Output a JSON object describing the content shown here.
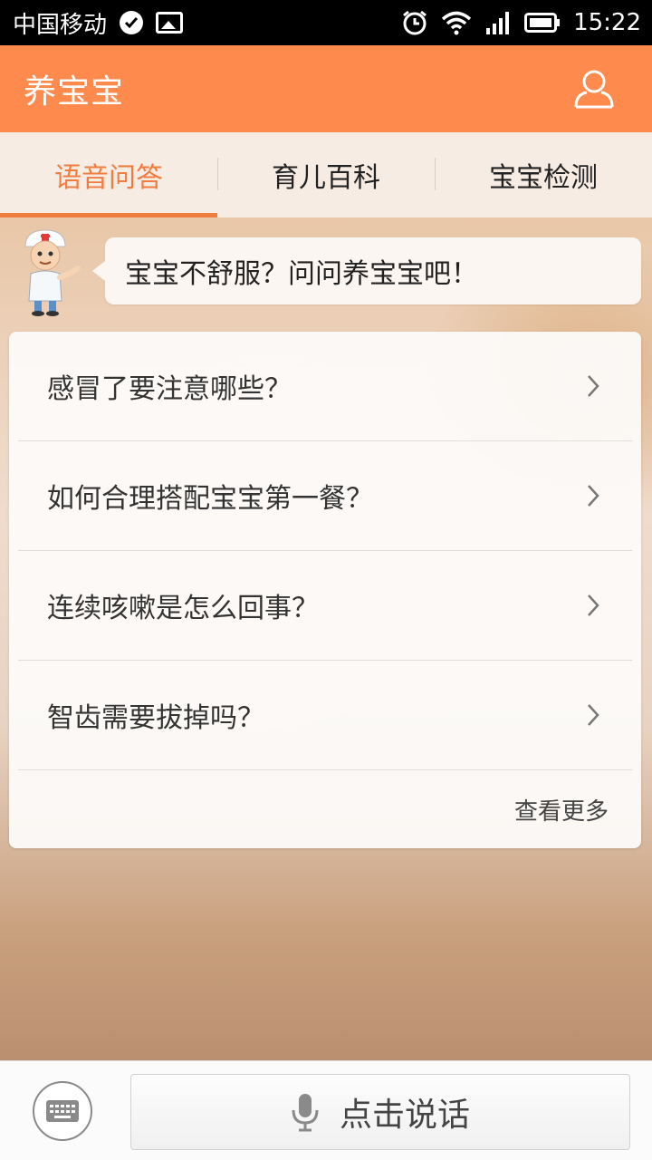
{
  "status_bar": {
    "carrier": "中国移动",
    "time": "15:22",
    "icons": [
      "check-circle-icon",
      "image-icon",
      "alarm-icon",
      "wifi-icon",
      "signal-icon",
      "battery-icon"
    ]
  },
  "header": {
    "title": "养宝宝",
    "profile_icon": "user-icon"
  },
  "tabs": [
    {
      "label": "语音问答",
      "active": true
    },
    {
      "label": "育儿百科",
      "active": false
    },
    {
      "label": "宝宝检测",
      "active": false
    }
  ],
  "assistant": {
    "avatar": "doctor-avatar",
    "message": "宝宝不舒服？问问养宝宝吧！"
  },
  "questions": [
    {
      "text": "感冒了要注意哪些？"
    },
    {
      "text": "如何合理搭配宝宝第一餐？"
    },
    {
      "text": "连续咳嗽是怎么回事？"
    },
    {
      "text": "智齿需要拔掉吗？"
    }
  ],
  "more_label": "查看更多",
  "bottom_bar": {
    "keyboard_icon": "keyboard-icon",
    "speak_label": "点击说话",
    "mic_icon": "microphone-icon"
  },
  "colors": {
    "accent": "#ff8a4e",
    "active_tab": "#f07d40"
  }
}
